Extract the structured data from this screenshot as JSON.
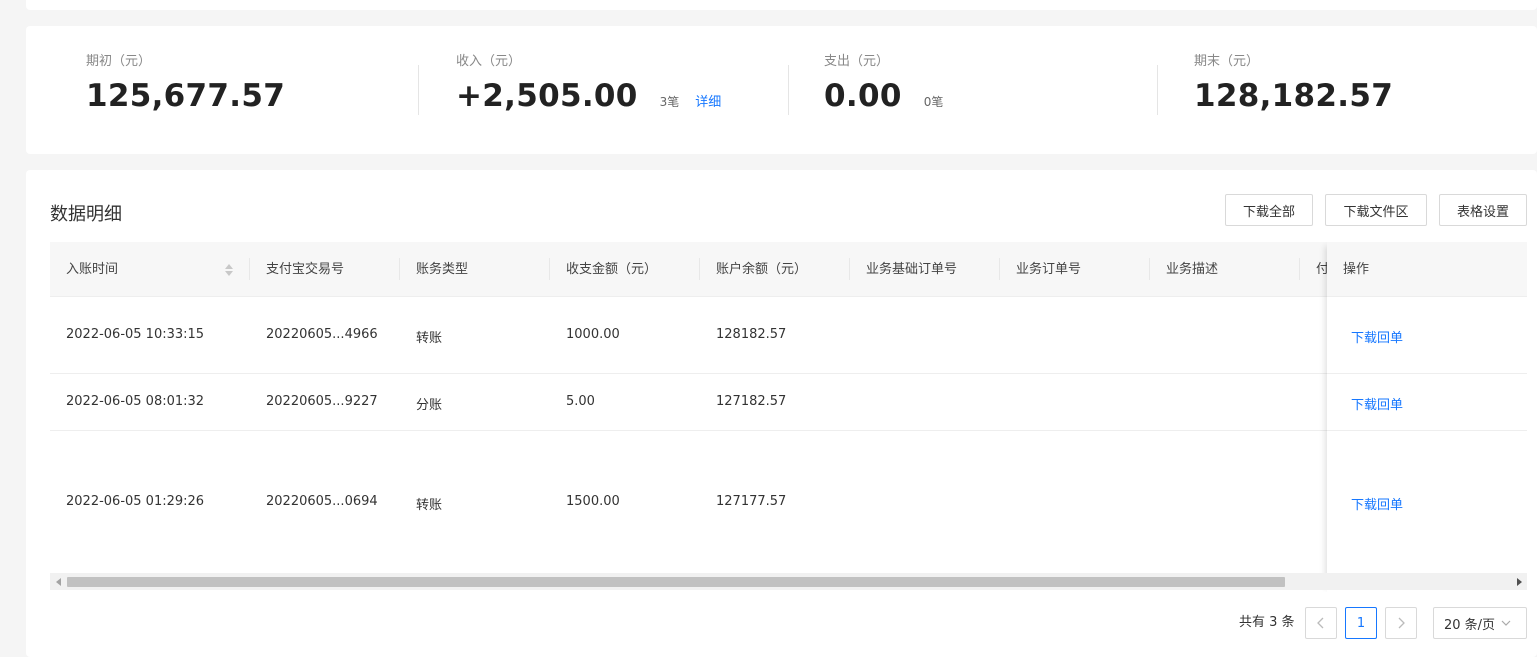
{
  "summary": {
    "opening": {
      "label": "期初（元）",
      "value": "125,677.57"
    },
    "income": {
      "label": "收入（元）",
      "value": "+2,505.00",
      "count": "3笔",
      "link": "详细"
    },
    "expense": {
      "label": "支出（元）",
      "value": "0.00",
      "count": "0笔"
    },
    "closing": {
      "label": "期末（元）",
      "value": "128,182.57"
    }
  },
  "detail": {
    "title": "数据明细",
    "buttons": {
      "download_all": "下载全部",
      "download_files": "下载文件区",
      "table_settings": "表格设置"
    }
  },
  "table": {
    "columns": [
      "入账时间",
      "支付宝交易号",
      "账务类型",
      "收支金额（元）",
      "账户余额（元）",
      "业务基础订单号",
      "业务订单号",
      "业务描述",
      "付"
    ],
    "action_column": "操作",
    "rows": [
      {
        "time": "2022-06-05 10:33:15",
        "trade_no": "20220605...4966",
        "type": "转账",
        "amount": "1000.00",
        "balance": "128182.57",
        "action": "下载回单"
      },
      {
        "time": "2022-06-05 08:01:32",
        "trade_no": "20220605...9227",
        "type": "分账",
        "amount": "5.00",
        "balance": "127182.57",
        "action": "下载回单"
      },
      {
        "time": "2022-06-05 01:29:26",
        "trade_no": "20220605...0694",
        "type": "转账",
        "amount": "1500.00",
        "balance": "127177.57",
        "action": "下载回单"
      }
    ]
  },
  "pagination": {
    "total": "共有 3 条",
    "current": "1",
    "page_size": "20 条/页"
  },
  "colors": {
    "accent": "#1677ff",
    "background": "#f5f5f5",
    "header": "#f7f7f7"
  }
}
